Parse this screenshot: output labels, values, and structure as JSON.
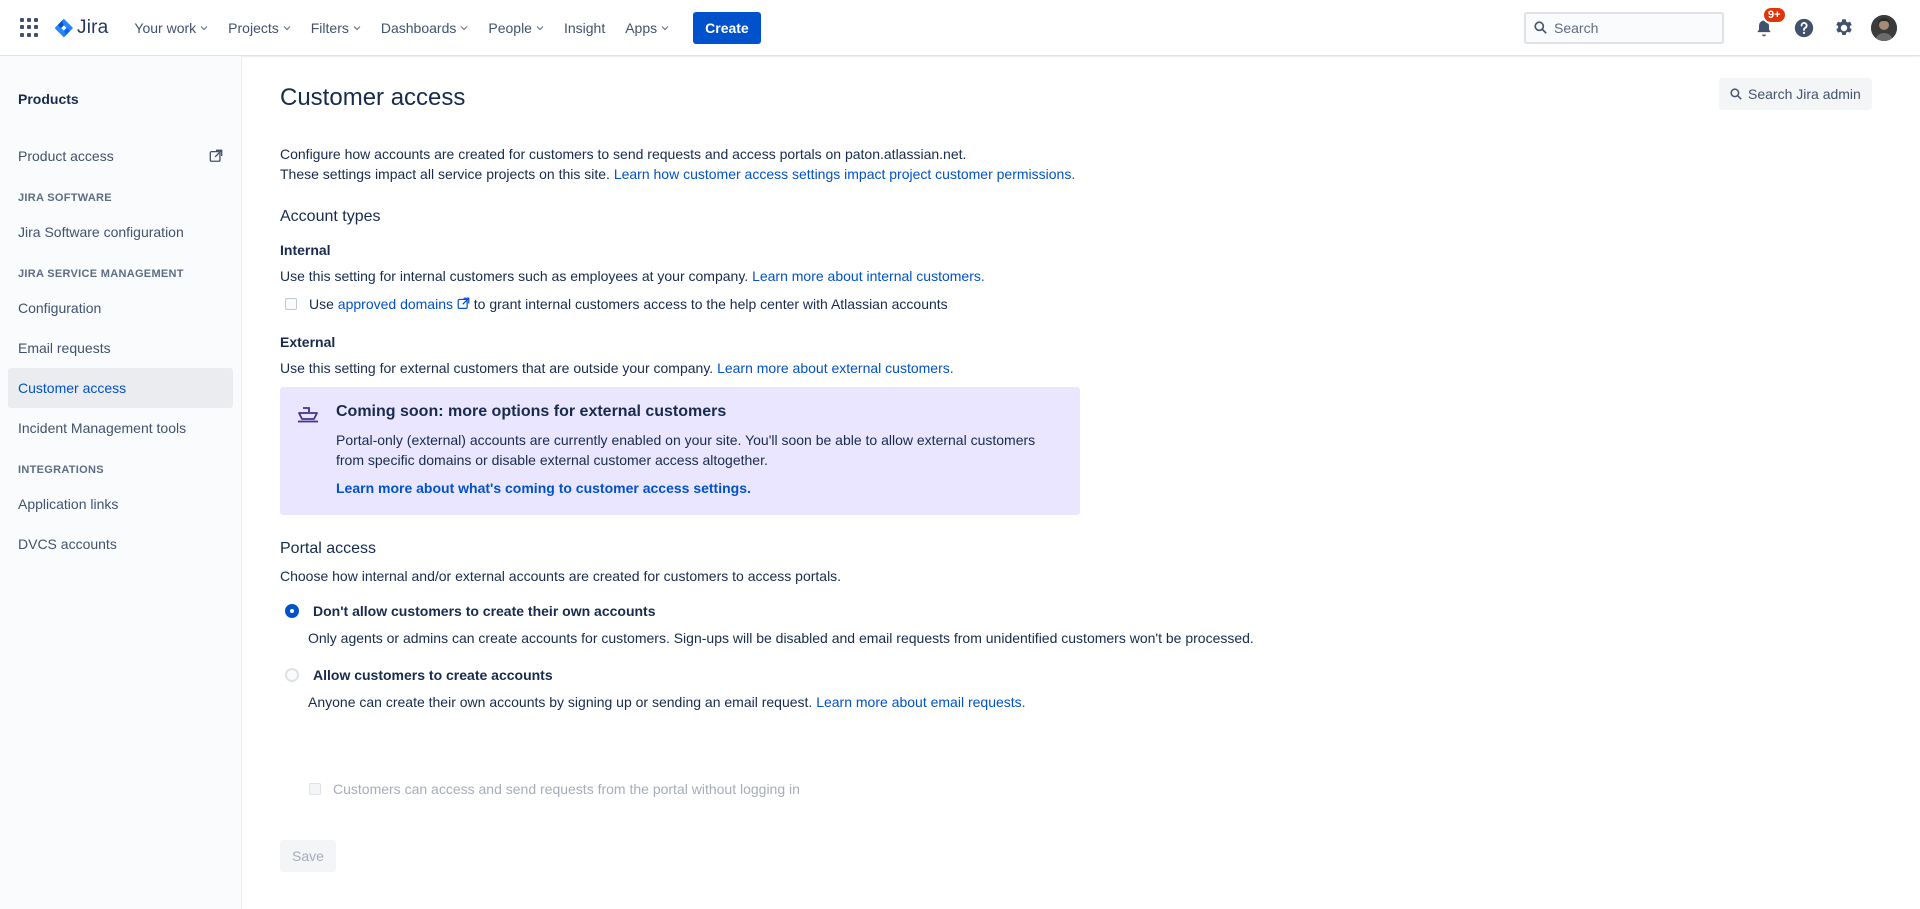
{
  "topnav": {
    "logo_text": "Jira",
    "items": [
      {
        "label": "Your work",
        "has_menu": true
      },
      {
        "label": "Projects",
        "has_menu": true
      },
      {
        "label": "Filters",
        "has_menu": true
      },
      {
        "label": "Dashboards",
        "has_menu": true
      },
      {
        "label": "People",
        "has_menu": true
      },
      {
        "label": "Insight",
        "has_menu": false
      },
      {
        "label": "Apps",
        "has_menu": true
      }
    ],
    "create_label": "Create",
    "search_placeholder": "Search",
    "notifications_badge": "9+",
    "icons": [
      "app-switcher-icon",
      "jira-logo-icon",
      "bell-icon",
      "help-icon",
      "settings-icon",
      "avatar"
    ]
  },
  "sidebar": {
    "title": "Products",
    "product_access": "Product access",
    "section_jira_software": "JIRA SOFTWARE",
    "jira_software_config": "Jira Software configuration",
    "section_jsm": "JIRA SERVICE MANAGEMENT",
    "configuration": "Configuration",
    "email_requests": "Email requests",
    "customer_access": "Customer access",
    "incident_tools": "Incident Management tools",
    "section_integrations": "INTEGRATIONS",
    "application_links": "Application links",
    "dvcs_accounts": "DVCS accounts"
  },
  "main": {
    "title": "Customer access",
    "search_admin_label": "Search Jira admin",
    "intro_line1": "Configure how accounts are created for customers to send requests and access portals on paton.atlassian.net.",
    "intro_line2": "These settings impact all service projects on this site.",
    "intro_link": "Learn how customer access settings impact project customer permissions.",
    "account_types_heading": "Account types",
    "internal_heading": "Internal",
    "internal_desc": "Use this setting for internal customers such as employees at your company.",
    "internal_link": "Learn more about internal customers.",
    "internal_check_pre": "Use",
    "internal_check_link": "approved domains",
    "internal_check_post": "to grant internal customers access to the help center with Atlassian accounts",
    "external_heading": "External",
    "external_desc": "Use this setting for external customers that are outside your company.",
    "external_link": "Learn more about external customers.",
    "info_panel": {
      "title": "Coming soon: more options for external customers",
      "body": "Portal-only (external) accounts are currently enabled on your site. You'll soon be able to allow external customers from specific domains or disable external customer access altogether.",
      "link": "Learn more about what's coming to customer access settings."
    },
    "portal_heading": "Portal access",
    "portal_desc": "Choose how internal and/or external accounts are created for customers to access portals.",
    "option1_label": "Don't allow customers to create their own accounts",
    "option1_desc": "Only agents or admins can create accounts for customers. Sign-ups will be disabled and email requests from unidentified customers won't be processed.",
    "option1_selected": true,
    "option2_label": "Allow customers to create accounts",
    "option2_desc": "Anyone can create their own accounts by signing up or sending an email request.",
    "option2_link": "Learn more about email requests.",
    "option2_selected": false,
    "option2_sub_check": "Customers can access and send requests from the portal without logging in",
    "save_label": "Save"
  },
  "colors": {
    "brand_blue": "#0052cc",
    "info_panel_bg": "#eae6ff",
    "badge_red": "#de350b"
  }
}
